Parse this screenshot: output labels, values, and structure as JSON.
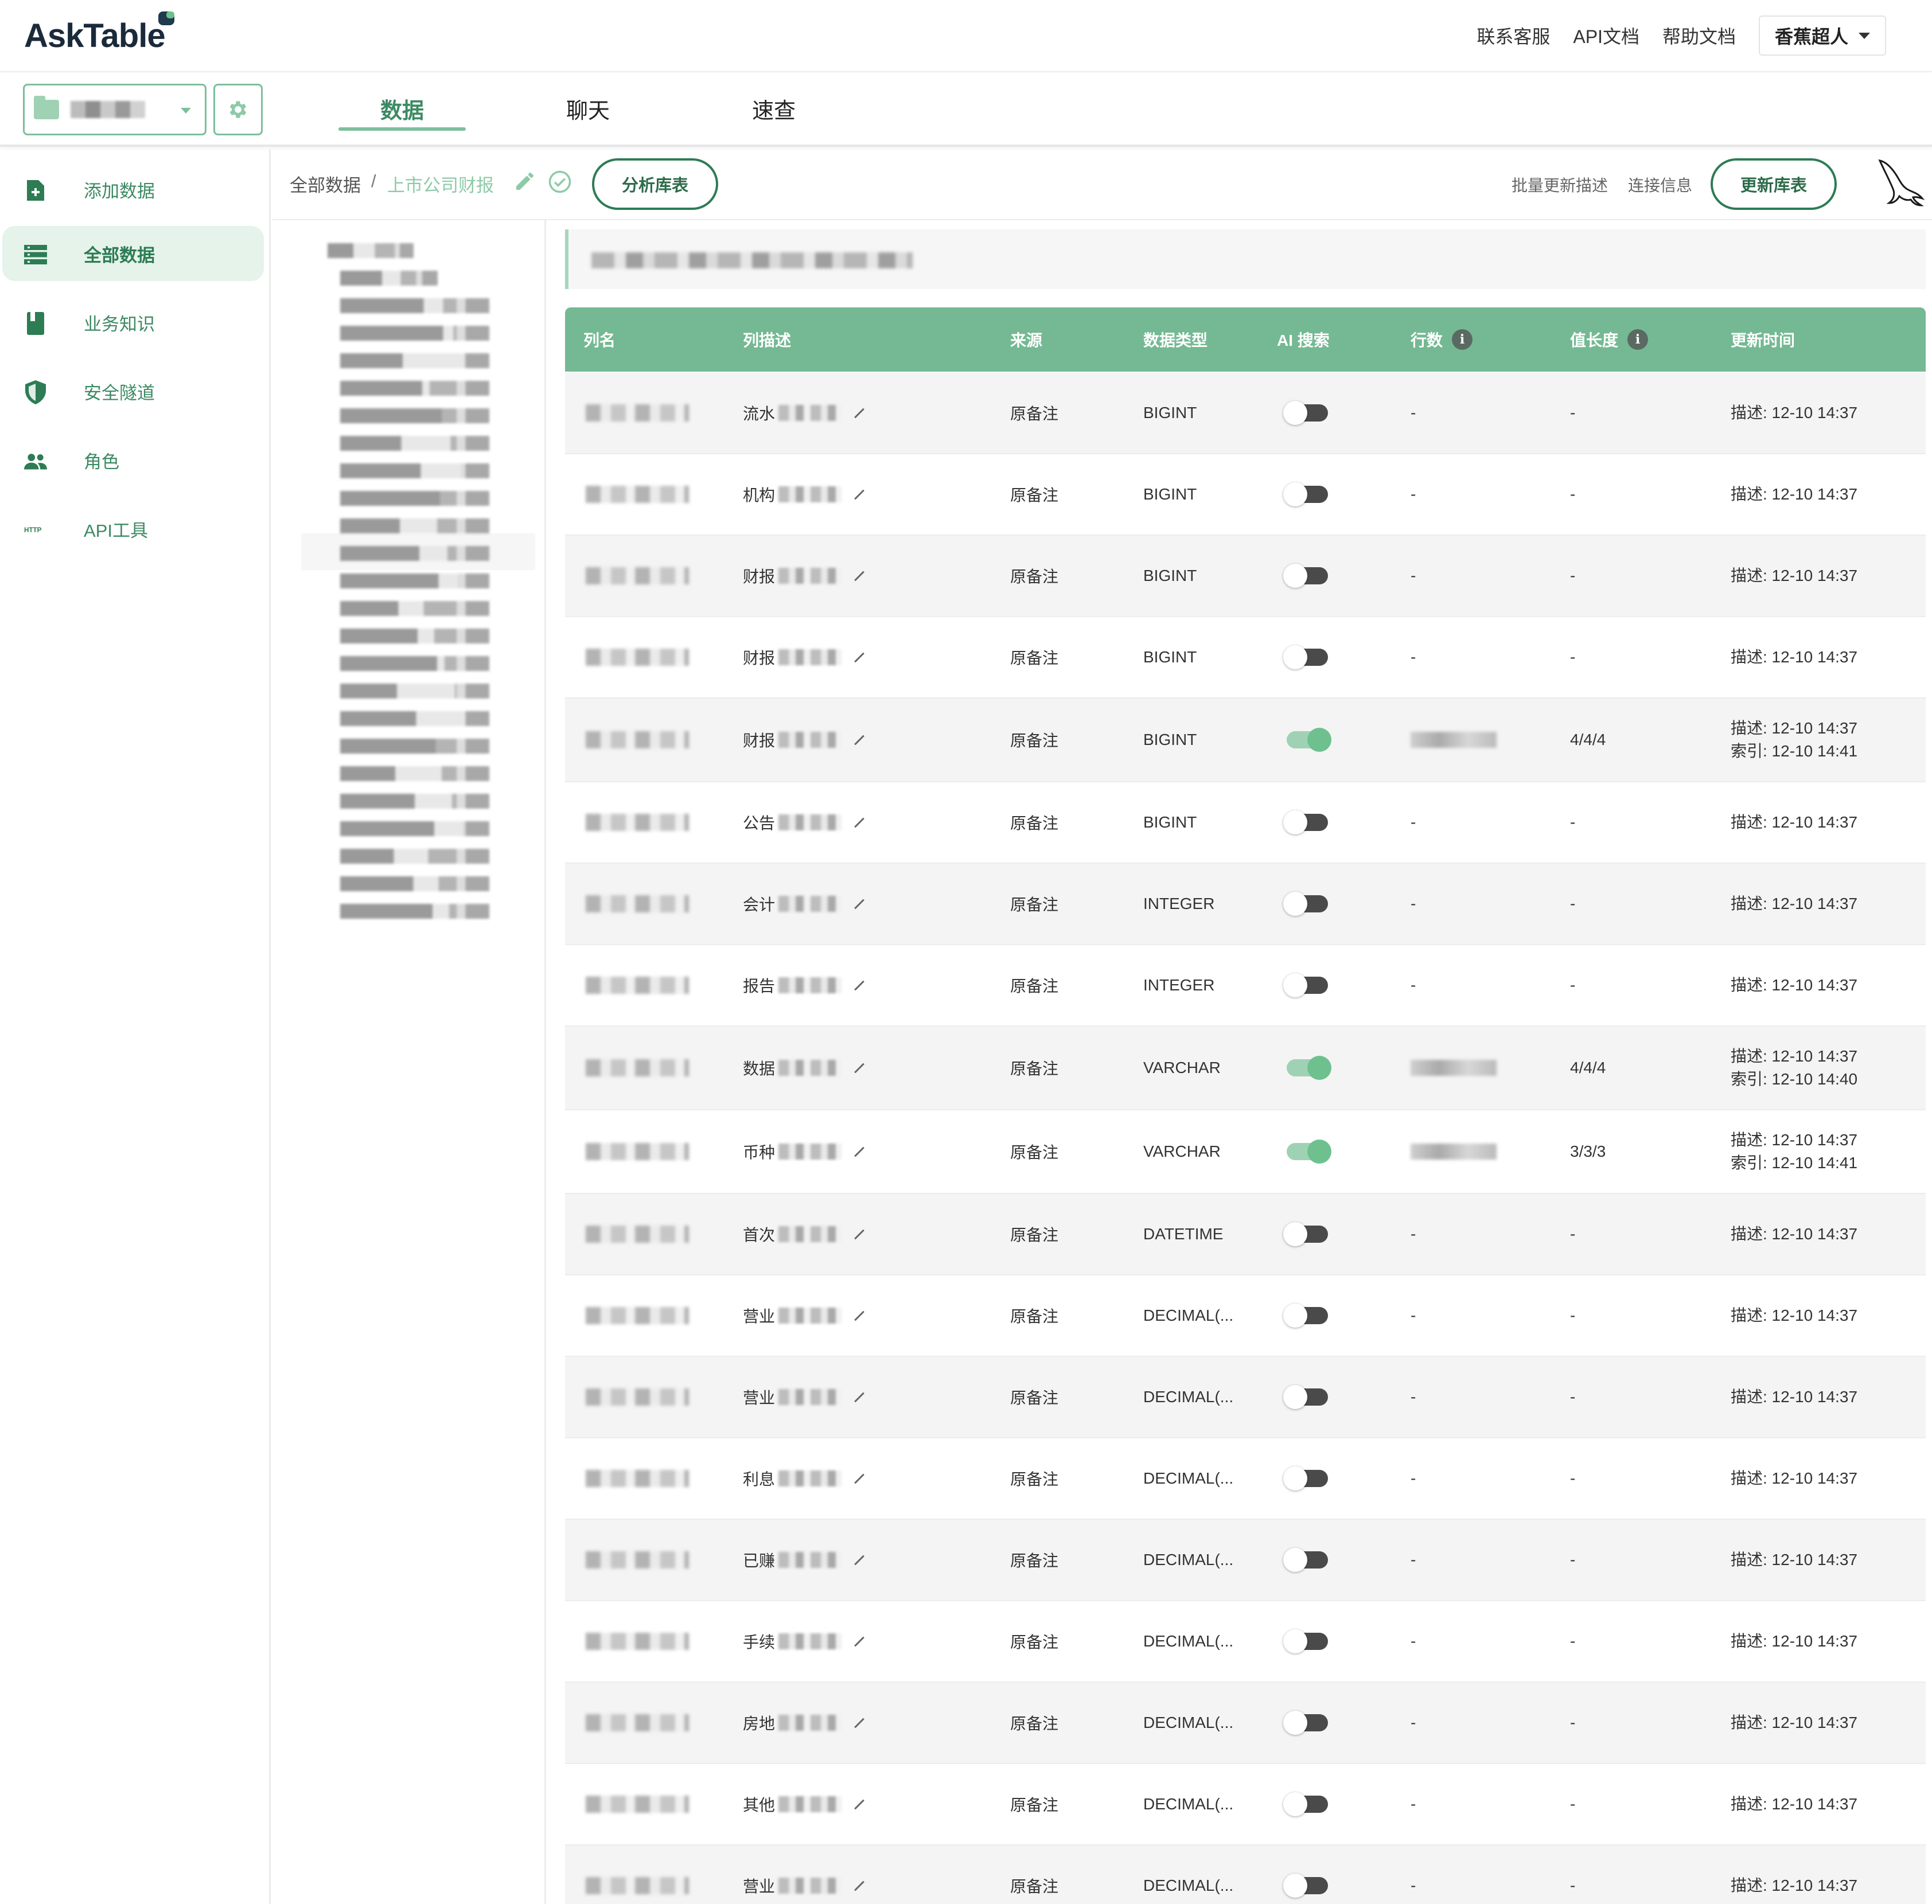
{
  "app": {
    "logo_text": "AskTable"
  },
  "top_links": [
    "联系客服",
    "API文档",
    "帮助文档"
  ],
  "user": {
    "name": "香蕉超人"
  },
  "tabs": [
    {
      "label": "数据",
      "active": true
    },
    {
      "label": "聊天",
      "active": false
    },
    {
      "label": "速查",
      "active": false
    }
  ],
  "sidebar": {
    "items": [
      {
        "label": "添加数据",
        "icon": "file-plus-icon",
        "active": false
      },
      {
        "label": "全部数据",
        "icon": "table-list-icon",
        "active": true
      },
      {
        "label": "业务知识",
        "icon": "book-icon",
        "active": false
      },
      {
        "label": "安全隧道",
        "icon": "shield-icon",
        "active": false
      },
      {
        "label": "角色",
        "icon": "users-icon",
        "active": false
      },
      {
        "label": "API工具",
        "icon": "http-icon",
        "active": false
      }
    ]
  },
  "toolbar": {
    "crumb_root": "全部数据",
    "crumb_sep": "/",
    "crumb_current": "上市公司财报",
    "analyze_btn": "分析库表",
    "batch_desc_link": "批量更新描述",
    "conn_info_link": "连接信息",
    "update_btn": "更新库表"
  },
  "table": {
    "headers": [
      "列名",
      "列描述",
      "来源",
      "数据类型",
      "AI 搜索",
      "行数",
      "值长度",
      "更新时间"
    ],
    "rows": [
      {
        "desc": "流水",
        "source": "原备注",
        "type": "BIGINT",
        "ai": false,
        "rows": "-",
        "len": "-",
        "upd": [
          "描述: 12-10 14:37"
        ]
      },
      {
        "desc": "机构",
        "source": "原备注",
        "type": "BIGINT",
        "ai": false,
        "rows": "-",
        "len": "-",
        "upd": [
          "描述: 12-10 14:37"
        ]
      },
      {
        "desc": "财报",
        "source": "原备注",
        "type": "BIGINT",
        "ai": false,
        "rows": "-",
        "len": "-",
        "upd": [
          "描述: 12-10 14:37"
        ]
      },
      {
        "desc": "财报",
        "source": "原备注",
        "type": "BIGINT",
        "ai": false,
        "rows": "-",
        "len": "-",
        "upd": [
          "描述: 12-10 14:37"
        ]
      },
      {
        "desc": "财报",
        "source": "原备注",
        "type": "BIGINT",
        "ai": true,
        "rows": "",
        "len": "4/4/4",
        "upd": [
          "描述: 12-10 14:37",
          "索引: 12-10 14:41"
        ]
      },
      {
        "desc": "公告",
        "source": "原备注",
        "type": "BIGINT",
        "ai": false,
        "rows": "-",
        "len": "-",
        "upd": [
          "描述: 12-10 14:37"
        ]
      },
      {
        "desc": "会计",
        "source": "原备注",
        "type": "INTEGER",
        "ai": false,
        "rows": "-",
        "len": "-",
        "upd": [
          "描述: 12-10 14:37"
        ]
      },
      {
        "desc": "报告",
        "source": "原备注",
        "type": "INTEGER",
        "ai": false,
        "rows": "-",
        "len": "-",
        "upd": [
          "描述: 12-10 14:37"
        ]
      },
      {
        "desc": "数据",
        "source": "原备注",
        "type": "VARCHAR",
        "ai": true,
        "rows": "",
        "len": "4/4/4",
        "upd": [
          "描述: 12-10 14:37",
          "索引: 12-10 14:40"
        ]
      },
      {
        "desc": "币种",
        "source": "原备注",
        "type": "VARCHAR",
        "ai": true,
        "rows": "",
        "len": "3/3/3",
        "upd": [
          "描述: 12-10 14:37",
          "索引: 12-10 14:41"
        ]
      },
      {
        "desc": "首次",
        "source": "原备注",
        "type": "DATETIME",
        "ai": false,
        "rows": "-",
        "len": "-",
        "upd": [
          "描述: 12-10 14:37"
        ]
      },
      {
        "desc": "营业",
        "source": "原备注",
        "type": "DECIMAL(...",
        "ai": false,
        "rows": "-",
        "len": "-",
        "upd": [
          "描述: 12-10 14:37"
        ]
      },
      {
        "desc": "营业",
        "source": "原备注",
        "type": "DECIMAL(...",
        "ai": false,
        "rows": "-",
        "len": "-",
        "upd": [
          "描述: 12-10 14:37"
        ]
      },
      {
        "desc": "利息",
        "source": "原备注",
        "type": "DECIMAL(...",
        "ai": false,
        "rows": "-",
        "len": "-",
        "upd": [
          "描述: 12-10 14:37"
        ]
      },
      {
        "desc": "已赚",
        "source": "原备注",
        "type": "DECIMAL(...",
        "ai": false,
        "rows": "-",
        "len": "-",
        "upd": [
          "描述: 12-10 14:37"
        ]
      },
      {
        "desc": "手续",
        "source": "原备注",
        "type": "DECIMAL(...",
        "ai": false,
        "rows": "-",
        "len": "-",
        "upd": [
          "描述: 12-10 14:37"
        ]
      },
      {
        "desc": "房地",
        "source": "原备注",
        "type": "DECIMAL(...",
        "ai": false,
        "rows": "-",
        "len": "-",
        "upd": [
          "描述: 12-10 14:37"
        ]
      },
      {
        "desc": "其他",
        "source": "原备注",
        "type": "DECIMAL(...",
        "ai": false,
        "rows": "-",
        "len": "-",
        "upd": [
          "描述: 12-10 14:37"
        ]
      },
      {
        "desc": "营业",
        "source": "原备注",
        "type": "DECIMAL(...",
        "ai": false,
        "rows": "-",
        "len": "-",
        "upd": [
          "描述: 12-10 14:37"
        ]
      }
    ]
  },
  "colors": {
    "accent": "#74b993",
    "accent_dark": "#2d7c54",
    "brand_text": "#1b2a3a"
  }
}
